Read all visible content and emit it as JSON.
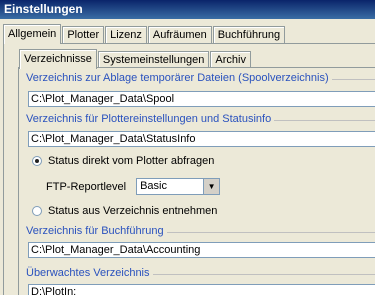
{
  "window": {
    "title": "Einstellungen"
  },
  "main_tabs": [
    "Allgemein",
    "Plotter",
    "Lizenz",
    "Aufräumen",
    "Buchführung"
  ],
  "sub_tabs": [
    "Verzeichnisse",
    "Systemeinstellungen",
    "Archiv"
  ],
  "groups": {
    "spool": {
      "label": "Verzeichnis zur Ablage temporärer Dateien (Spoolverzeichnis)",
      "value": "C:\\Plot_Manager_Data\\Spool"
    },
    "status": {
      "label": "Verzeichnis für Plottereinstellungen und Statusinfo",
      "value": "C:\\Plot_Manager_Data\\StatusInfo"
    },
    "accounting": {
      "label": "Verzeichnis für Buchführung",
      "value": "C:\\Plot_Manager_Data\\Accounting"
    },
    "watched": {
      "label": "Überwachtes Verzeichnis",
      "value": "D:\\PlotIn:"
    }
  },
  "status_options": {
    "direct": "Status direkt vom Plotter abfragen",
    "from_dir": "Status aus Verzeichnis entnehmen",
    "selected": "direct"
  },
  "ftp": {
    "label": "FTP-Reportlevel",
    "value": "Basic"
  }
}
